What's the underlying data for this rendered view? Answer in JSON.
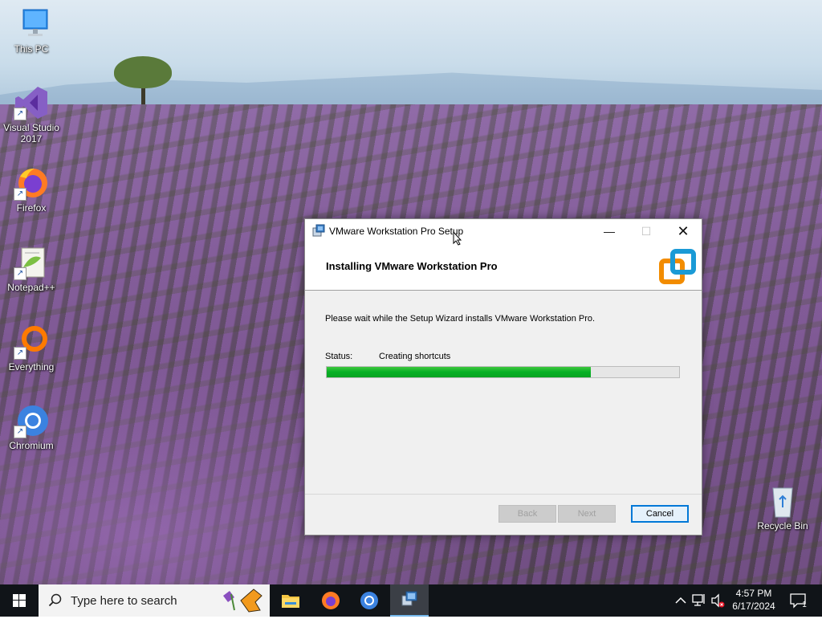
{
  "desktop": {
    "icons": [
      {
        "label": "This PC"
      },
      {
        "label": "Visual Studio 2017"
      },
      {
        "label": "Firefox"
      },
      {
        "label": "Notepad++"
      },
      {
        "label": "Everything"
      },
      {
        "label": "Chromium"
      },
      {
        "label": "Recycle Bin"
      }
    ]
  },
  "window": {
    "title": "VMware Workstation Pro Setup",
    "header_title": "Installing VMware Workstation Pro",
    "message": "Please wait while the Setup Wizard installs VMware Workstation Pro.",
    "status_label": "Status:",
    "status_value": "Creating shortcuts",
    "progress": 0.75,
    "buttons": {
      "back": "Back",
      "next": "Next",
      "cancel": "Cancel"
    }
  },
  "taskbar": {
    "search_placeholder": "Type here to search",
    "time": "4:57 PM",
    "date": "6/17/2024",
    "notification_count": "1"
  },
  "colors": {
    "progress_fill": "#06b025",
    "accent": "#0078d7",
    "taskbar": "#101418"
  }
}
